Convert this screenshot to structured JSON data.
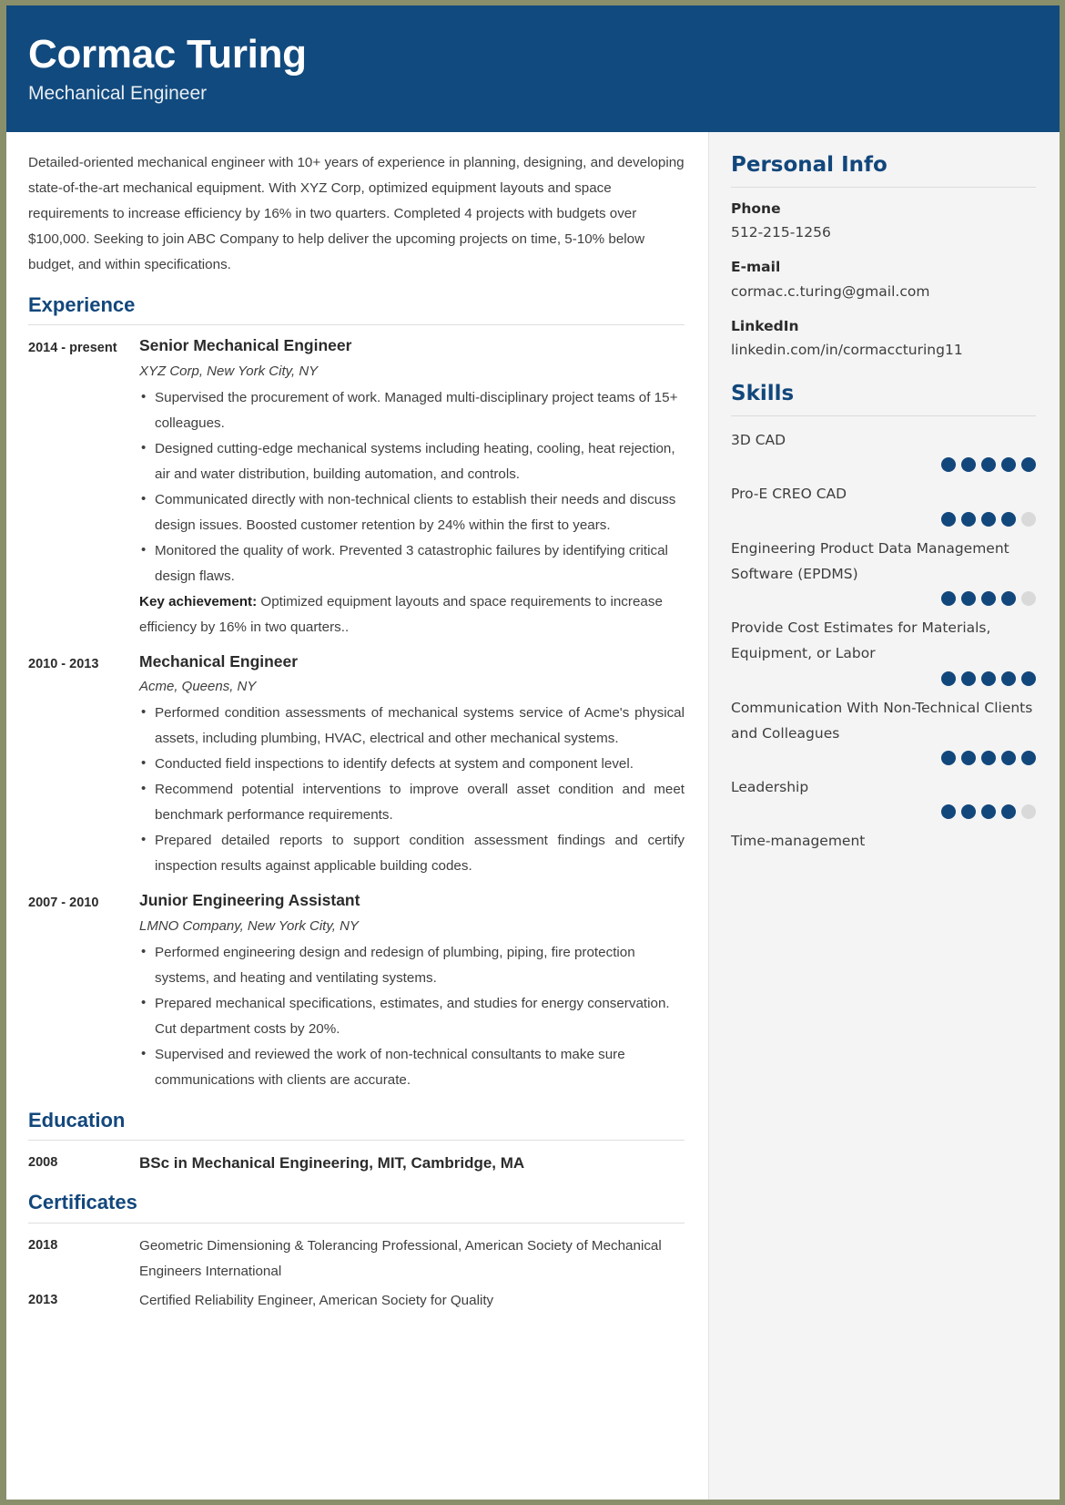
{
  "colors": {
    "brand_blue": "#114A7E",
    "heading_blue": "#12477C",
    "sidebar_bg": "#f4f4f4",
    "page_border": "#8a8f6b",
    "dot_on": "#12477C",
    "dot_off": "#d9d9d9"
  },
  "header": {
    "name": "Cormac Turing",
    "title": "Mechanical Engineer"
  },
  "summary": "Detailed-oriented mechanical engineer with 10+ years of experience in planning, designing, and developing state-of-the-art mechanical equipment. With XYZ Corp, optimized equipment layouts and space requirements to increase efficiency by 16% in two quarters. Completed 4 projects with budgets over $100,000. Seeking to join ABC Company to help deliver the upcoming projects on time, 5-10% below budget, and within specifications.",
  "sections": {
    "experience_heading": "Experience",
    "education_heading": "Education",
    "certificates_heading": "Certificates"
  },
  "experience": [
    {
      "dates": "2014 - present",
      "role": "Senior Mechanical Engineer",
      "org": "XYZ Corp, New York City, NY",
      "bullets": [
        "Supervised the procurement of work. Managed multi-disciplinary project teams of 15+ colleagues.",
        "Designed cutting-edge mechanical systems including heating, cooling, heat rejection, air and water distribution, building automation, and controls.",
        "Communicated directly with non-technical clients to establish their needs and discuss design issues. Boosted customer retention by 24% within the first to years.",
        "Monitored the quality of work. Prevented 3 catastrophic failures by identifying critical design flaws."
      ],
      "key_achievement_label": "Key achievement:",
      "key_achievement_text": " Optimized equipment layouts and space requirements to increase efficiency by 16% in two quarters.."
    },
    {
      "dates": "2010 - 2013",
      "role": "Mechanical Engineer",
      "org": "Acme, Queens, NY",
      "bullets": [
        "Performed condition assessments of mechanical systems service of Acme's physical assets, including plumbing, HVAC, electrical and other mechanical systems.",
        "Conducted field inspections to identify defects at system and component level.",
        "Recommend potential interventions to improve overall asset condition and meet benchmark performance requirements.",
        "Prepared detailed reports to support condition assessment findings and certify inspection results against applicable building codes."
      ],
      "key_achievement_label": "",
      "key_achievement_text": ""
    },
    {
      "dates": "2007 - 2010",
      "role": "Junior Engineering Assistant",
      "org": "LMNO Company, New York City, NY",
      "bullets": [
        "Performed engineering design and redesign of plumbing, piping, fire protection systems, and heating and ventilating systems.",
        "Prepared mechanical specifications, estimates, and studies for energy conservation. Cut department costs by 20%.",
        "Supervised and reviewed the work of non-technical consultants to make sure communications with clients are accurate."
      ],
      "key_achievement_label": "",
      "key_achievement_text": ""
    }
  ],
  "education": [
    {
      "year": "2008",
      "text": "BSc in Mechanical Engineering, MIT, Cambridge, MA"
    }
  ],
  "certificates": [
    {
      "year": "2018",
      "text": "Geometric Dimensioning & Tolerancing Professional, American Society of Mechanical Engineers International"
    },
    {
      "year": "2013",
      "text": "Certified Reliability Engineer, American Society for Quality"
    }
  ],
  "sidebar": {
    "personal_info_heading": "Personal Info",
    "skills_heading": "Skills",
    "info": [
      {
        "label": "Phone",
        "value": "512-215-1256"
      },
      {
        "label": "E-mail",
        "value": "cormac.c.turing@gmail.com"
      },
      {
        "label": "LinkedIn",
        "value": "linkedin.com/in/cormaccturing11"
      }
    ],
    "skills": [
      {
        "name": "3D CAD",
        "rating": 5,
        "max": 5,
        "show_dots": true
      },
      {
        "name": "Pro-E CREO CAD",
        "rating": 4,
        "max": 5,
        "show_dots": true
      },
      {
        "name": "Engineering Product Data Management Software (EPDMS)",
        "rating": 4,
        "max": 5,
        "show_dots": true
      },
      {
        "name": "Provide Cost Estimates for Materials, Equipment, or Labor",
        "rating": 5,
        "max": 5,
        "show_dots": true
      },
      {
        "name": "Communication With Non-Technical Clients and Colleagues",
        "rating": 5,
        "max": 5,
        "show_dots": true
      },
      {
        "name": "Leadership",
        "rating": 4,
        "max": 5,
        "show_dots": true
      },
      {
        "name": "Time-management",
        "rating": 0,
        "max": 5,
        "show_dots": false
      }
    ]
  }
}
